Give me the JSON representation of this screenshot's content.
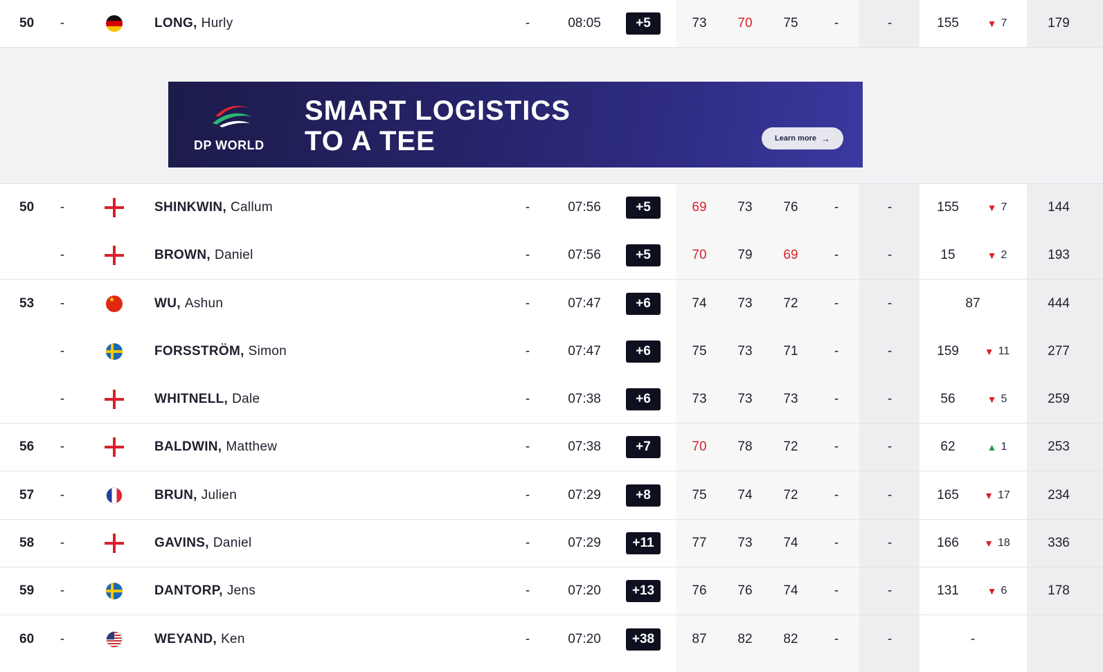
{
  "ad": {
    "brand": "DP WORLD",
    "headline_line1": "SMART LOGISTICS",
    "headline_line2": "TO A TEE",
    "cta_label": "Learn more",
    "colors": {
      "background": "#26246a",
      "swoosh_red": "#e6262f",
      "swoosh_green": "#2bb673"
    }
  },
  "rows": [
    {
      "pos": "50",
      "move": "-",
      "flag": "germany-flag",
      "last": "LONG,",
      "first": "Hurly",
      "thru": "-",
      "tee": "08:05",
      "score": "+5",
      "r1": "73",
      "r2": "70",
      "r3": "75",
      "r4": "-",
      "total": "-",
      "rank": "155",
      "change": "7",
      "dir": "down",
      "points": "179",
      "r1_red": false,
      "r2_red": true,
      "r3_red": false
    },
    {
      "pos": "50",
      "move": "-",
      "flag": "england-flag",
      "last": "SHINKWIN,",
      "first": "Callum",
      "thru": "-",
      "tee": "07:56",
      "score": "+5",
      "r1": "69",
      "r2": "73",
      "r3": "76",
      "r4": "-",
      "total": "-",
      "rank": "155",
      "change": "7",
      "dir": "down",
      "points": "144",
      "r1_red": true,
      "r2_red": false,
      "r3_red": false
    },
    {
      "pos": "",
      "move": "-",
      "flag": "england-flag",
      "last": "BROWN,",
      "first": "Daniel",
      "thru": "-",
      "tee": "07:56",
      "score": "+5",
      "r1": "70",
      "r2": "79",
      "r3": "69",
      "r4": "-",
      "total": "-",
      "rank": "15",
      "change": "2",
      "dir": "down",
      "points": "193",
      "r1_red": true,
      "r2_red": false,
      "r3_red": true
    },
    {
      "pos": "53",
      "move": "-",
      "flag": "china-flag",
      "last": "WU,",
      "first": "Ashun",
      "thru": "-",
      "tee": "07:47",
      "score": "+6",
      "r1": "74",
      "r2": "73",
      "r3": "72",
      "r4": "-",
      "total": "-",
      "rank": "87",
      "change": "",
      "dir": "none",
      "points": "444",
      "r1_red": false,
      "r2_red": false,
      "r3_red": false
    },
    {
      "pos": "",
      "move": "-",
      "flag": "sweden-flag",
      "last": "FORSSTRÖM,",
      "first": "Simon",
      "thru": "-",
      "tee": "07:47",
      "score": "+6",
      "r1": "75",
      "r2": "73",
      "r3": "71",
      "r4": "-",
      "total": "-",
      "rank": "159",
      "change": "11",
      "dir": "down",
      "points": "277",
      "r1_red": false,
      "r2_red": false,
      "r3_red": false
    },
    {
      "pos": "",
      "move": "-",
      "flag": "england-flag",
      "last": "WHITNELL,",
      "first": "Dale",
      "thru": "-",
      "tee": "07:38",
      "score": "+6",
      "r1": "73",
      "r2": "73",
      "r3": "73",
      "r4": "-",
      "total": "-",
      "rank": "56",
      "change": "5",
      "dir": "down",
      "points": "259",
      "r1_red": false,
      "r2_red": false,
      "r3_red": false
    },
    {
      "pos": "56",
      "move": "-",
      "flag": "england-flag",
      "last": "BALDWIN,",
      "first": "Matthew",
      "thru": "-",
      "tee": "07:38",
      "score": "+7",
      "r1": "70",
      "r2": "78",
      "r3": "72",
      "r4": "-",
      "total": "-",
      "rank": "62",
      "change": "1",
      "dir": "up",
      "points": "253",
      "r1_red": true,
      "r2_red": false,
      "r3_red": false
    },
    {
      "pos": "57",
      "move": "-",
      "flag": "france-flag",
      "last": "BRUN,",
      "first": "Julien",
      "thru": "-",
      "tee": "07:29",
      "score": "+8",
      "r1": "75",
      "r2": "74",
      "r3": "72",
      "r4": "-",
      "total": "-",
      "rank": "165",
      "change": "17",
      "dir": "down",
      "points": "234",
      "r1_red": false,
      "r2_red": false,
      "r3_red": false
    },
    {
      "pos": "58",
      "move": "-",
      "flag": "england-flag",
      "last": "GAVINS,",
      "first": "Daniel",
      "thru": "-",
      "tee": "07:29",
      "score": "+11",
      "r1": "77",
      "r2": "73",
      "r3": "74",
      "r4": "-",
      "total": "-",
      "rank": "166",
      "change": "18",
      "dir": "down",
      "points": "336",
      "r1_red": false,
      "r2_red": false,
      "r3_red": false
    },
    {
      "pos": "59",
      "move": "-",
      "flag": "sweden-flag",
      "last": "DANTORP,",
      "first": "Jens",
      "thru": "-",
      "tee": "07:20",
      "score": "+13",
      "r1": "76",
      "r2": "76",
      "r3": "74",
      "r4": "-",
      "total": "-",
      "rank": "131",
      "change": "6",
      "dir": "down",
      "points": "178",
      "r1_red": false,
      "r2_red": false,
      "r3_red": false
    },
    {
      "pos": "60",
      "move": "-",
      "flag": "usa-flag",
      "last": "WEYAND,",
      "first": "Ken",
      "thru": "-",
      "tee": "07:20",
      "score": "+38",
      "r1": "87",
      "r2": "82",
      "r3": "82",
      "r4": "-",
      "total": "-",
      "rank": "-",
      "change": "",
      "dir": "none",
      "points": "",
      "r1_red": false,
      "r2_red": false,
      "r3_red": false
    }
  ]
}
